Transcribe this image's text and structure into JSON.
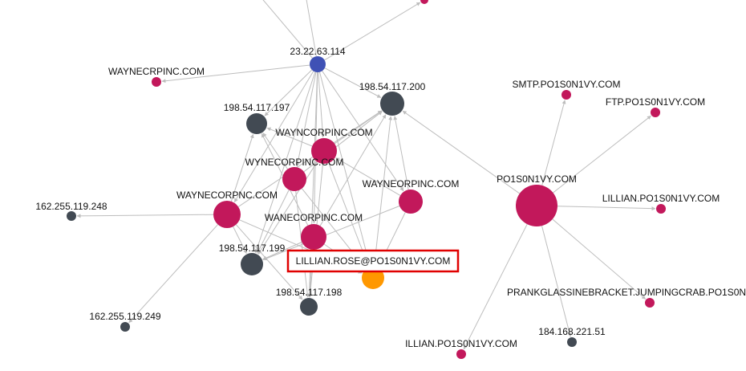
{
  "colors": {
    "domain": "#c2185b",
    "ip": "#424a53",
    "hub_ip": "#3f51b5",
    "email": "#ff9800",
    "edge": "#bdbdbd",
    "highlight": "#e00000"
  },
  "nodes": [
    {
      "id": "hub_ip",
      "label": "23.22.63.114",
      "kind": "hub_ip"
    },
    {
      "id": "top_domain",
      "label": "",
      "kind": "domain"
    },
    {
      "id": "waynecrpinc",
      "label": "WAYNECRPINC.COM",
      "kind": "domain"
    },
    {
      "id": "ip200",
      "label": "198.54.117.200",
      "kind": "ip"
    },
    {
      "id": "ip197",
      "label": "198.54.117.197",
      "kind": "ip"
    },
    {
      "id": "wayncorpinc",
      "label": "WAYNCORPINC.COM",
      "kind": "domain"
    },
    {
      "id": "wynecorpinc",
      "label": "WYNECORPINC.COM",
      "kind": "domain"
    },
    {
      "id": "wayneorpinc",
      "label": "WAYNEORPINC.COM",
      "kind": "domain"
    },
    {
      "id": "waynecorpnc",
      "label": "WAYNECORPNC.COM",
      "kind": "domain"
    },
    {
      "id": "wanecorpinc",
      "label": "WANECORPINC.COM",
      "kind": "domain"
    },
    {
      "id": "ip248",
      "label": "162.255.119.248",
      "kind": "ip"
    },
    {
      "id": "ip199",
      "label": "198.54.117.199",
      "kind": "ip"
    },
    {
      "id": "email",
      "label": "LILLIAN.ROSE@PO1S0N1VY.COM",
      "kind": "email",
      "highlighted": true
    },
    {
      "id": "ip198",
      "label": "198.54.117.198",
      "kind": "ip"
    },
    {
      "id": "ip249",
      "label": "162.255.119.249",
      "kind": "ip"
    },
    {
      "id": "po1s0n1vy",
      "label": "PO1S0N1VY.COM",
      "kind": "domain"
    },
    {
      "id": "smtp",
      "label": "SMTP.PO1S0N1VY.COM",
      "kind": "domain"
    },
    {
      "id": "ftp",
      "label": "FTP.PO1S0N1VY.COM",
      "kind": "domain"
    },
    {
      "id": "lillian",
      "label": "LILLIAN.PO1S0N1VY.COM",
      "kind": "domain"
    },
    {
      "id": "prank",
      "label": "PRANKGLASSINEBRACKET.JUMPINGCRAB.PO1S0N1VY.COM",
      "kind": "domain"
    },
    {
      "id": "ip184",
      "label": "184.168.221.51",
      "kind": "ip"
    },
    {
      "id": "illian",
      "label": "ILLIAN.PO1S0N1VY.COM",
      "kind": "domain"
    }
  ],
  "edges": [
    [
      "hub_ip",
      "top_domain"
    ],
    [
      "hub_ip",
      "waynecrpinc"
    ],
    [
      "hub_ip",
      "ip200"
    ],
    [
      "hub_ip",
      "ip197"
    ],
    [
      "hub_ip",
      "wayncorpinc"
    ],
    [
      "hub_ip",
      "wynecorpinc"
    ],
    [
      "hub_ip",
      "wanecorpinc"
    ],
    [
      "hub_ip",
      "waynecorpnc"
    ],
    [
      "hub_ip",
      "wayneorpinc"
    ],
    [
      "hub_ip",
      "ip199"
    ],
    [
      "hub_ip",
      "email"
    ],
    [
      "hub_ip",
      "ip198"
    ],
    [
      "hub_ip",
      "offscreen_a"
    ],
    [
      "hub_ip",
      "offscreen_b"
    ],
    [
      "wayncorpinc",
      "ip200"
    ],
    [
      "wayncorpinc",
      "ip197"
    ],
    [
      "wayncorpinc",
      "ip199"
    ],
    [
      "wayncorpinc",
      "ip198"
    ],
    [
      "wayncorpinc",
      "email"
    ],
    [
      "wynecorpinc",
      "ip200"
    ],
    [
      "wynecorpinc",
      "ip197"
    ],
    [
      "wynecorpinc",
      "ip199"
    ],
    [
      "wynecorpinc",
      "ip198"
    ],
    [
      "wynecorpinc",
      "email"
    ],
    [
      "wayneorpinc",
      "ip200"
    ],
    [
      "wayneorpinc",
      "wayncorpinc"
    ],
    [
      "wayneorpinc",
      "ip199"
    ],
    [
      "wayneorpinc",
      "email"
    ],
    [
      "waynecorpnc",
      "ip200"
    ],
    [
      "waynecorpnc",
      "ip197"
    ],
    [
      "waynecorpnc",
      "ip199"
    ],
    [
      "waynecorpnc",
      "ip198"
    ],
    [
      "waynecorpnc",
      "ip248"
    ],
    [
      "waynecorpnc",
      "ip249"
    ],
    [
      "waynecorpnc",
      "email"
    ],
    [
      "wanecorpinc",
      "ip200"
    ],
    [
      "wanecorpinc",
      "ip197"
    ],
    [
      "wanecorpinc",
      "ip199"
    ],
    [
      "wanecorpinc",
      "ip198"
    ],
    [
      "wanecorpinc",
      "email"
    ],
    [
      "email",
      "ip200"
    ],
    [
      "po1s0n1vy",
      "ip200"
    ],
    [
      "po1s0n1vy",
      "smtp"
    ],
    [
      "po1s0n1vy",
      "ftp"
    ],
    [
      "po1s0n1vy",
      "lillian"
    ],
    [
      "po1s0n1vy",
      "prank"
    ],
    [
      "po1s0n1vy",
      "ip184"
    ],
    [
      "po1s0n1vy",
      "illian"
    ]
  ]
}
